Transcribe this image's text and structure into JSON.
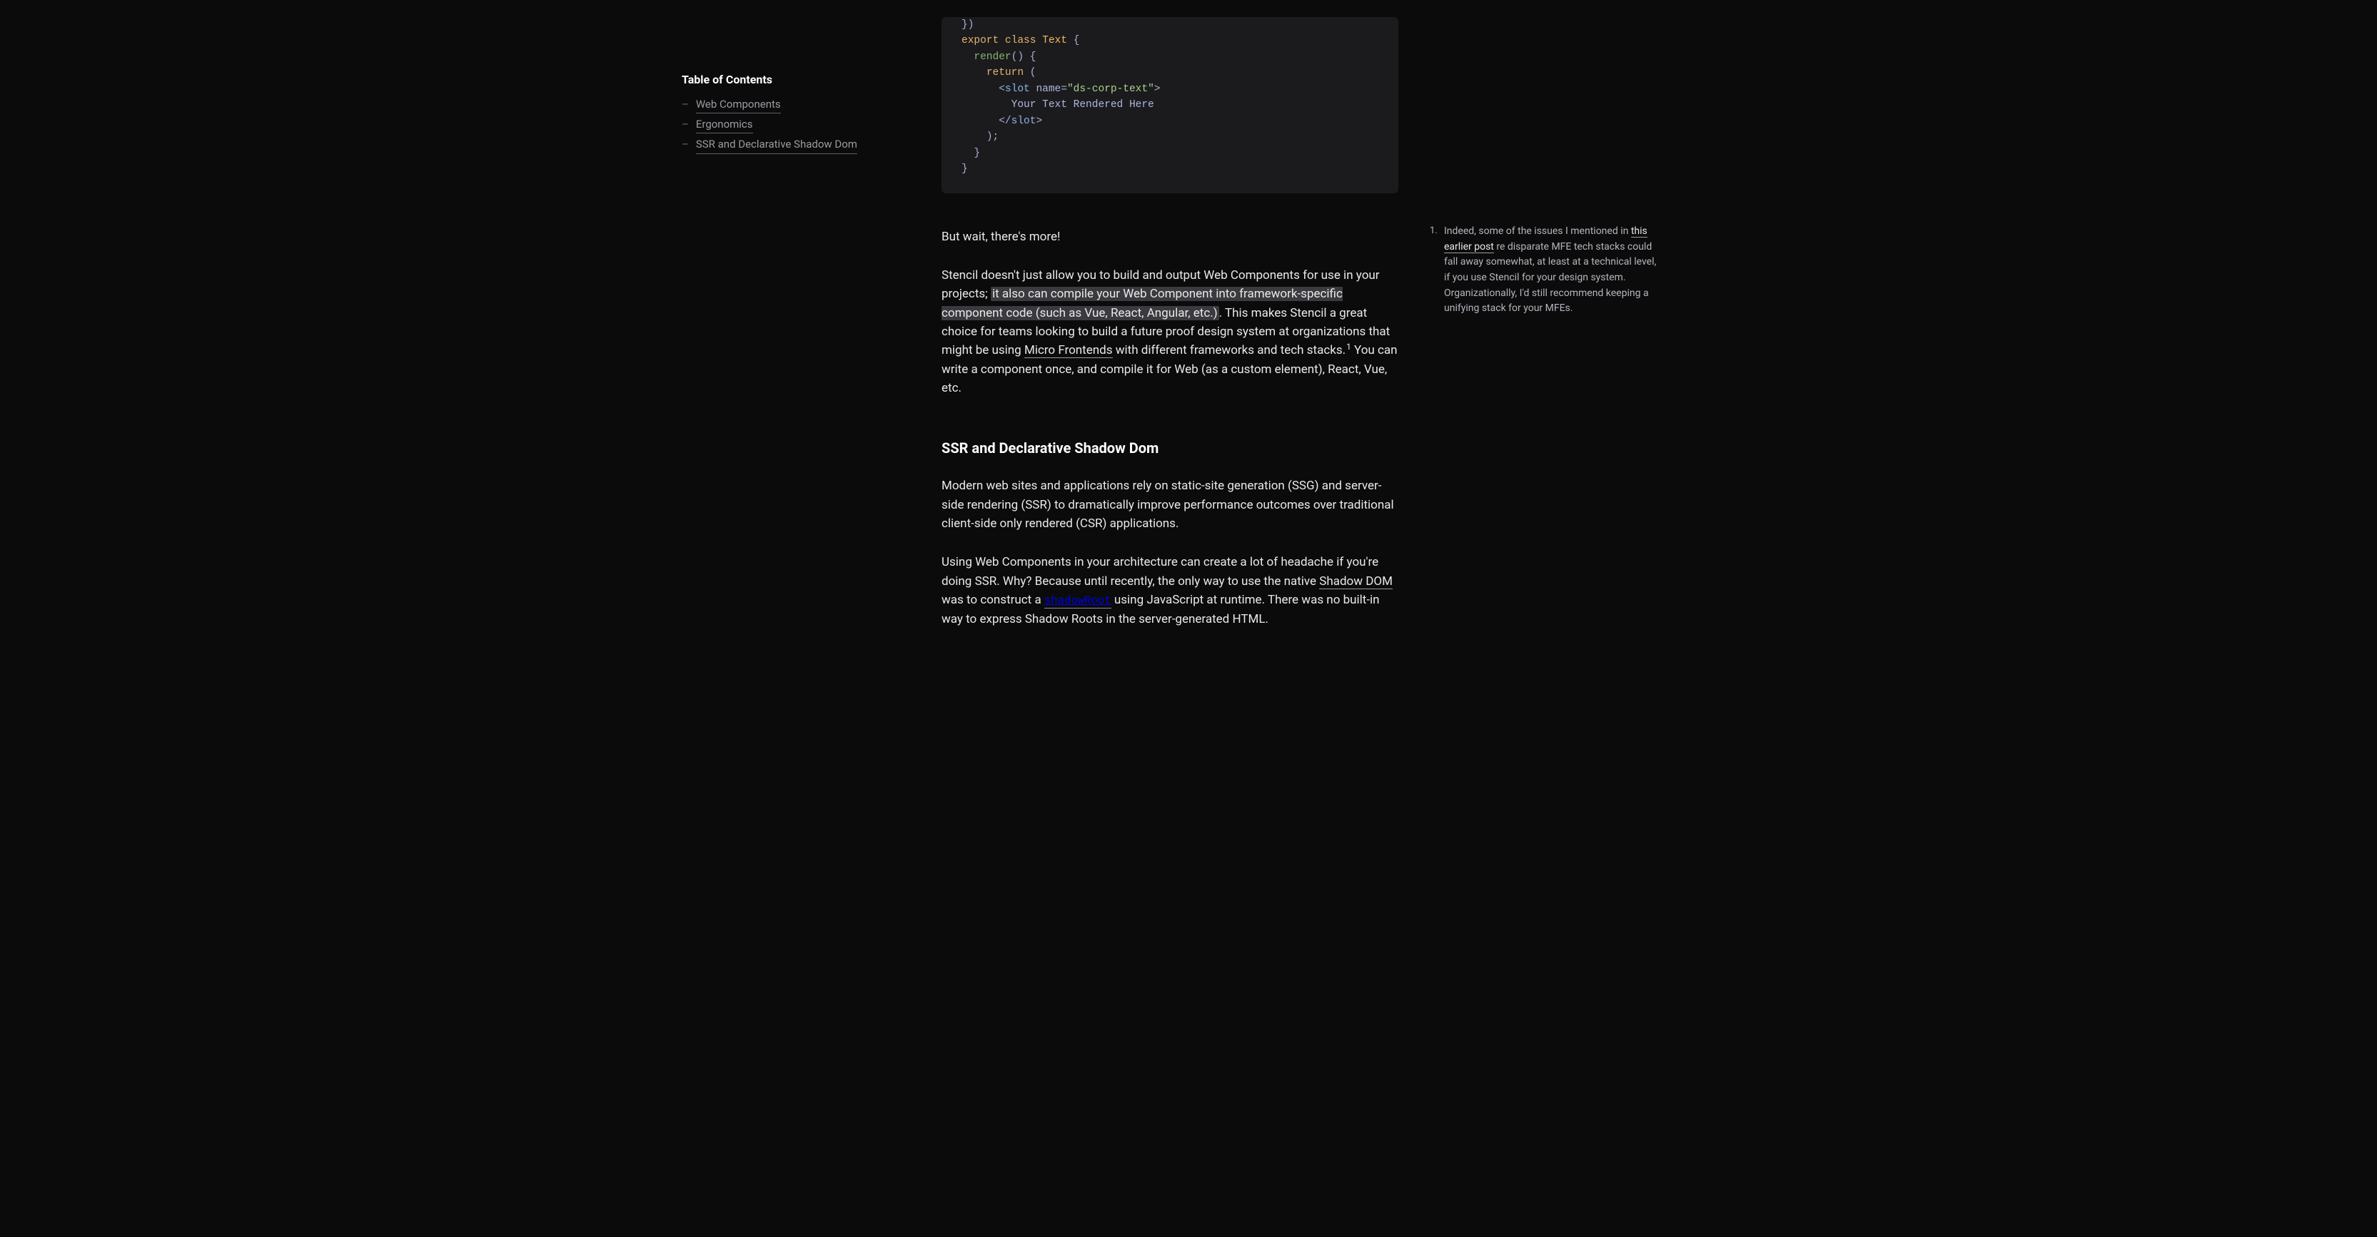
{
  "toc": {
    "title": "Table of Contents",
    "items": [
      {
        "label": "Web Components"
      },
      {
        "label": "Ergonomics"
      },
      {
        "label": "SSR and Declarative Shadow Dom"
      }
    ]
  },
  "code": {
    "l0a": "})",
    "l1_kw1": "export",
    "l1_kw2": "class",
    "l1_type": "Text",
    "l1_brace": "{",
    "l2_fn": "render",
    "l2_rest": "() {",
    "l3_kw": "return",
    "l3_paren": " (",
    "l4_open": "<",
    "l4_tag": "slot",
    "l4_sp": " ",
    "l4_attr": "name",
    "l4_eq": "=",
    "l4_str": "\"ds-corp-text\"",
    "l4_close": ">",
    "l5_text": "Your Text Rendered Here",
    "l6_open": "</",
    "l6_tag": "slot",
    "l6_close": ">",
    "l7": ");",
    "l8": "}",
    "l9": "}"
  },
  "para_wait": "But wait, there's more!",
  "para_compile": {
    "pre": "Stencil doesn't just allow you to build and output Web Components for use in your projects; ",
    "hl": "it also can compile your Web Component into framework-specific component code (such as Vue, React, Angular, etc.)",
    "mid": ". This makes Stencil a great choice for teams looking to build a future proof design system at organizations that might be using ",
    "link": "Micro Frontends",
    "post_link": " with different frameworks and tech stacks.",
    "fn": "1",
    "tail": " You can write a component once, and compile it for Web (as a custom element), React, Vue, etc."
  },
  "section_title": "SSR and Declarative Shadow Dom",
  "para_modern": "Modern web sites and applications rely on static-site generation (SSG) and server-side rendering (SSR) to dramatically improve performance outcomes over traditional client-side only rendered (CSR) applications.",
  "para_using": {
    "a": "Using Web Components in your architecture can create a lot of headache if you're doing SSR. Why? Because until recently, the only way to use the native ",
    "link1": "Shadow DOM",
    "b": " was to construct a ",
    "code": "shadowRoot",
    "c": " using JavaScript at runtime. There was no built-in way to express Shadow Roots in the server-generated HTML."
  },
  "sidenote": {
    "marker": "1.",
    "a": "Indeed, some of the issues I mentioned in ",
    "link": "this earlier post",
    "b": " re disparate MFE tech stacks could fall away somewhat, at least at a technical level, if you use Stencil for your design system. Organizationally, I'd still recommend keeping a unifying stack for your MFEs."
  }
}
